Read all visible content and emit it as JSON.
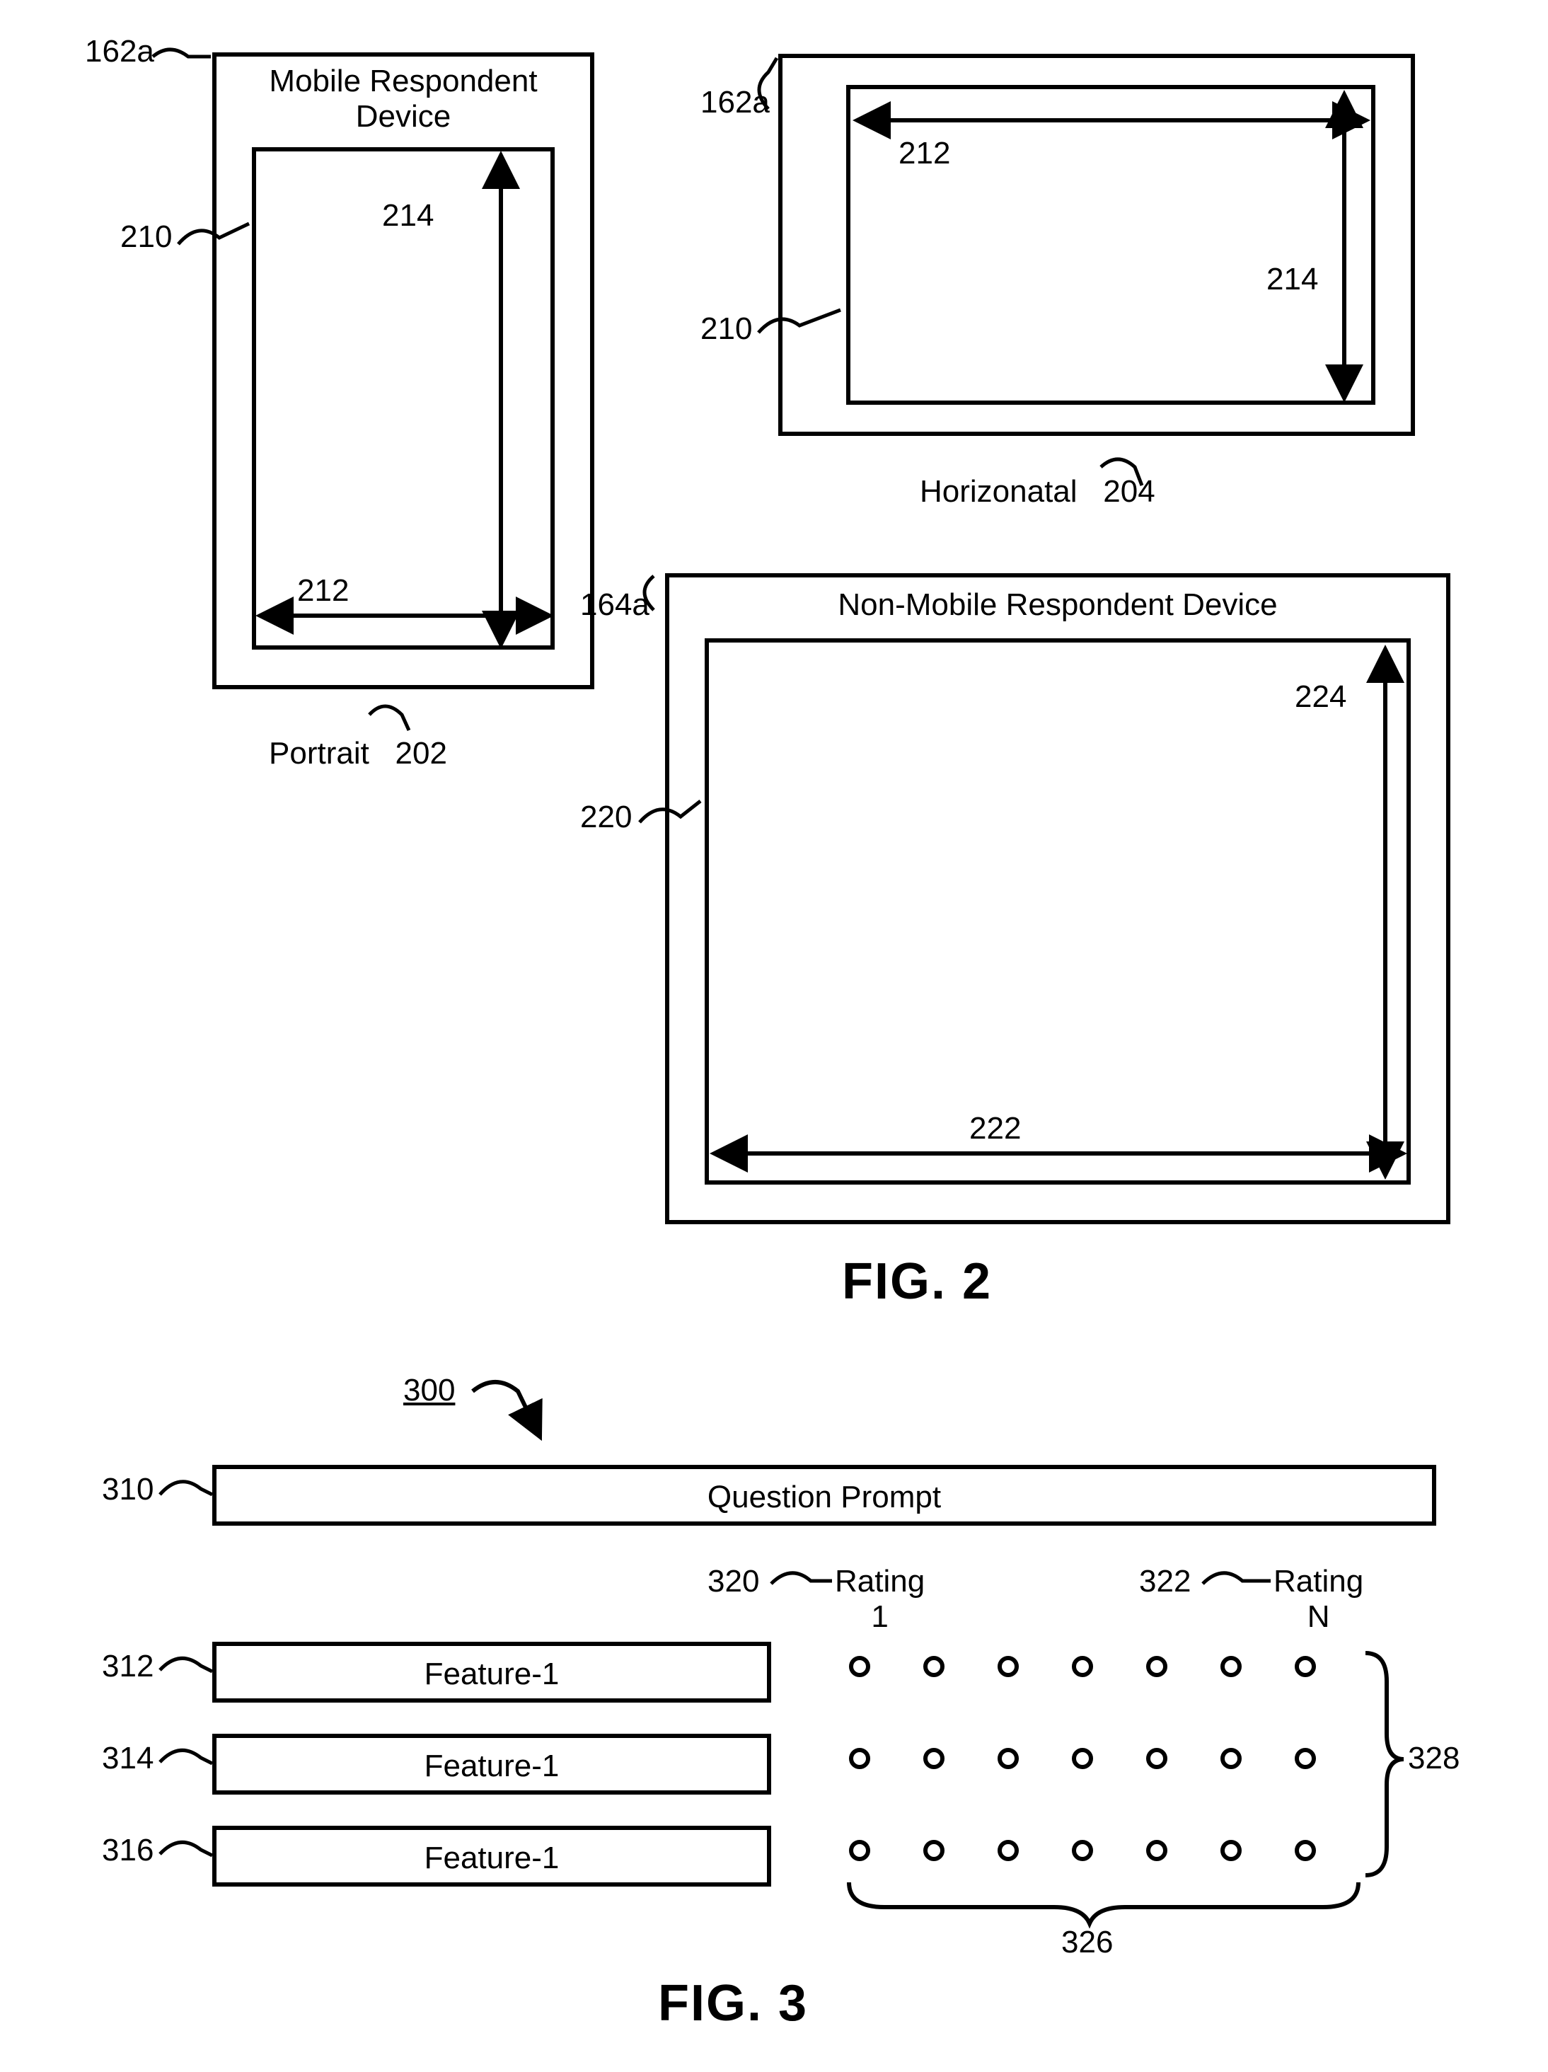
{
  "fig2": {
    "title": "FIG. 2",
    "portrait": {
      "title_line1": "Mobile Respondent",
      "title_line2": "Device",
      "caption_label": "Portrait",
      "caption_num": "202",
      "ref_outer": "162a",
      "ref_inner": "210",
      "ref_h": "212",
      "ref_v": "214"
    },
    "horizontal": {
      "caption_label": "Horizonatal",
      "caption_num": "204",
      "ref_outer": "162a",
      "ref_inner": "210",
      "ref_h": "212",
      "ref_v": "214"
    },
    "nonmobile": {
      "title": "Non-Mobile Respondent Device",
      "ref_outer": "164a",
      "ref_inner": "220",
      "ref_h": "222",
      "ref_v": "224"
    }
  },
  "fig3": {
    "title": "FIG. 3",
    "ref_main": "300",
    "prompt": {
      "label": "Question Prompt",
      "ref": "310"
    },
    "features": [
      {
        "label": "Feature-1",
        "ref": "312"
      },
      {
        "label": "Feature-1",
        "ref": "314"
      },
      {
        "label": "Feature-1",
        "ref": "316"
      }
    ],
    "rating1": {
      "label_top": "Rating",
      "label_bot": "1",
      "ref": "320"
    },
    "ratingN": {
      "label_top": "Rating",
      "label_bot": "N",
      "ref": "322"
    },
    "rating_cols": 7,
    "ref_cols": "326",
    "ref_rows": "328"
  }
}
